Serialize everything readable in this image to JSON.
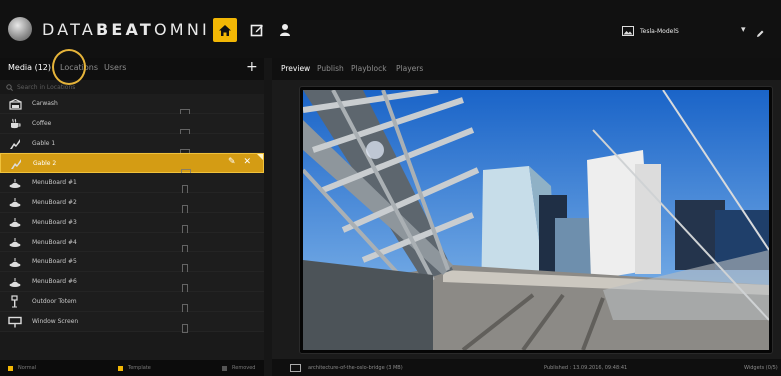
{
  "header": {
    "brand_prefix": "DATA",
    "brand_bold": "BEAT",
    "brand_suffix": "OMNI",
    "device_name": "Tesla-ModelS",
    "accent": "#f2b705"
  },
  "left_tabs": [
    "Media (12)",
    "Locations",
    "Users"
  ],
  "search": {
    "placeholder": "Search in Locations"
  },
  "locations": [
    {
      "label": "Carwash",
      "icon": "carwash-icon",
      "orientation": "landscape"
    },
    {
      "label": "Coffee",
      "icon": "coffee-icon",
      "orientation": "landscape"
    },
    {
      "label": "Gable 1",
      "icon": "gable-icon",
      "orientation": "landscape"
    },
    {
      "label": "Gable 2",
      "icon": "gable-icon",
      "orientation": "landscape",
      "selected": true
    },
    {
      "label": "MenuBoard #1",
      "icon": "menuboard-icon",
      "orientation": "portrait"
    },
    {
      "label": "MenuBoard #2",
      "icon": "menuboard-icon",
      "orientation": "portrait"
    },
    {
      "label": "MenuBoard #3",
      "icon": "menuboard-icon",
      "orientation": "portrait"
    },
    {
      "label": "MenuBoard #4",
      "icon": "menuboard-icon",
      "orientation": "portrait"
    },
    {
      "label": "MenuBoard #5",
      "icon": "menuboard-icon",
      "orientation": "portrait"
    },
    {
      "label": "MenuBoard #6",
      "icon": "menuboard-icon",
      "orientation": "portrait"
    },
    {
      "label": "Outdoor Totem",
      "icon": "totem-icon",
      "orientation": "portrait"
    },
    {
      "label": "Window Screen",
      "icon": "window-screen-icon",
      "orientation": "portrait"
    }
  ],
  "legend": [
    {
      "label": "Normal",
      "color": "#f2b705"
    },
    {
      "label": "Template",
      "color": "#f2b705"
    },
    {
      "label": "Removed",
      "color": "#555555"
    }
  ],
  "right_tabs": [
    "Preview",
    "Publish",
    "Playblock",
    "Players"
  ],
  "status": {
    "file": "architecture-of-the-oslo-bridge (3 MB)",
    "published": "Published : 13.09.2016, 09:48:41",
    "widgets": "Widgets (0/5)"
  }
}
